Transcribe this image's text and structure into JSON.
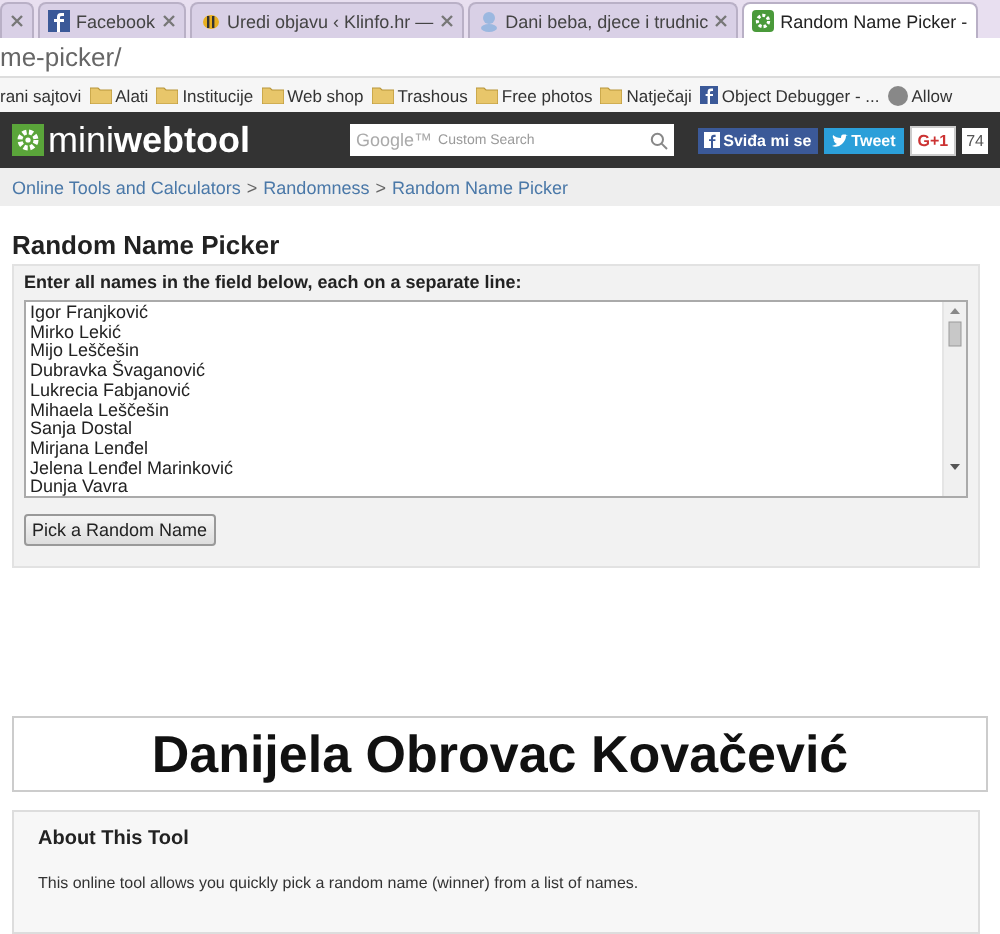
{
  "browser": {
    "tabs": [
      {
        "selected": false
      },
      {
        "title": "Facebook",
        "selected": false
      },
      {
        "title": "Uredi objavu ‹ Klinfo.hr —",
        "selected": false
      },
      {
        "title": "Dani beba, djece i trudnic",
        "selected": false
      },
      {
        "title": "Random Name Picker -",
        "selected": true
      }
    ],
    "address": "me-picker/",
    "bookmarks": [
      {
        "label": "rani sajtovi",
        "kind": "none"
      },
      {
        "label": "Alati",
        "kind": "folder"
      },
      {
        "label": "Institucije",
        "kind": "folder"
      },
      {
        "label": "Web shop",
        "kind": "folder"
      },
      {
        "label": "Trashous",
        "kind": "folder"
      },
      {
        "label": "Free photos",
        "kind": "folder"
      },
      {
        "label": "Natječaji",
        "kind": "folder"
      },
      {
        "label": "Object Debugger - ...",
        "kind": "facebook"
      },
      {
        "label": "Allow",
        "kind": "avatar"
      }
    ]
  },
  "header": {
    "logo_light": "mini",
    "logo_bold": "webtool",
    "search_placeholder": "Custom Search",
    "search_brand": "Google™",
    "like": "Sviđa mi se",
    "tweet": "Tweet",
    "gplus": "G+1",
    "count": "74"
  },
  "breadcrumb": [
    "Online Tools and Calculators",
    ">",
    "Randomness",
    ">",
    "Random Name Picker"
  ],
  "title": "Random Name Picker",
  "form": {
    "label": "Enter all names in the field below, each on a separate line:",
    "names": [
      "Igor Franjković",
      "Mirko Lekić",
      "Mijo Leščešin",
      "Dubravka Švaganović",
      "Lukrecia Fabjanović",
      "Mihaela Leščešin",
      "Sanja Dostal",
      "Mirjana Lenđel",
      "Jelena Lenđel Marinković",
      "Dunja Vavra"
    ],
    "button": "Pick a Random Name"
  },
  "result": "Danijela Obrovac Kovačević",
  "about": {
    "title": "About This Tool",
    "text": "This online tool allows you quickly pick a random name (winner) from a list of names."
  }
}
